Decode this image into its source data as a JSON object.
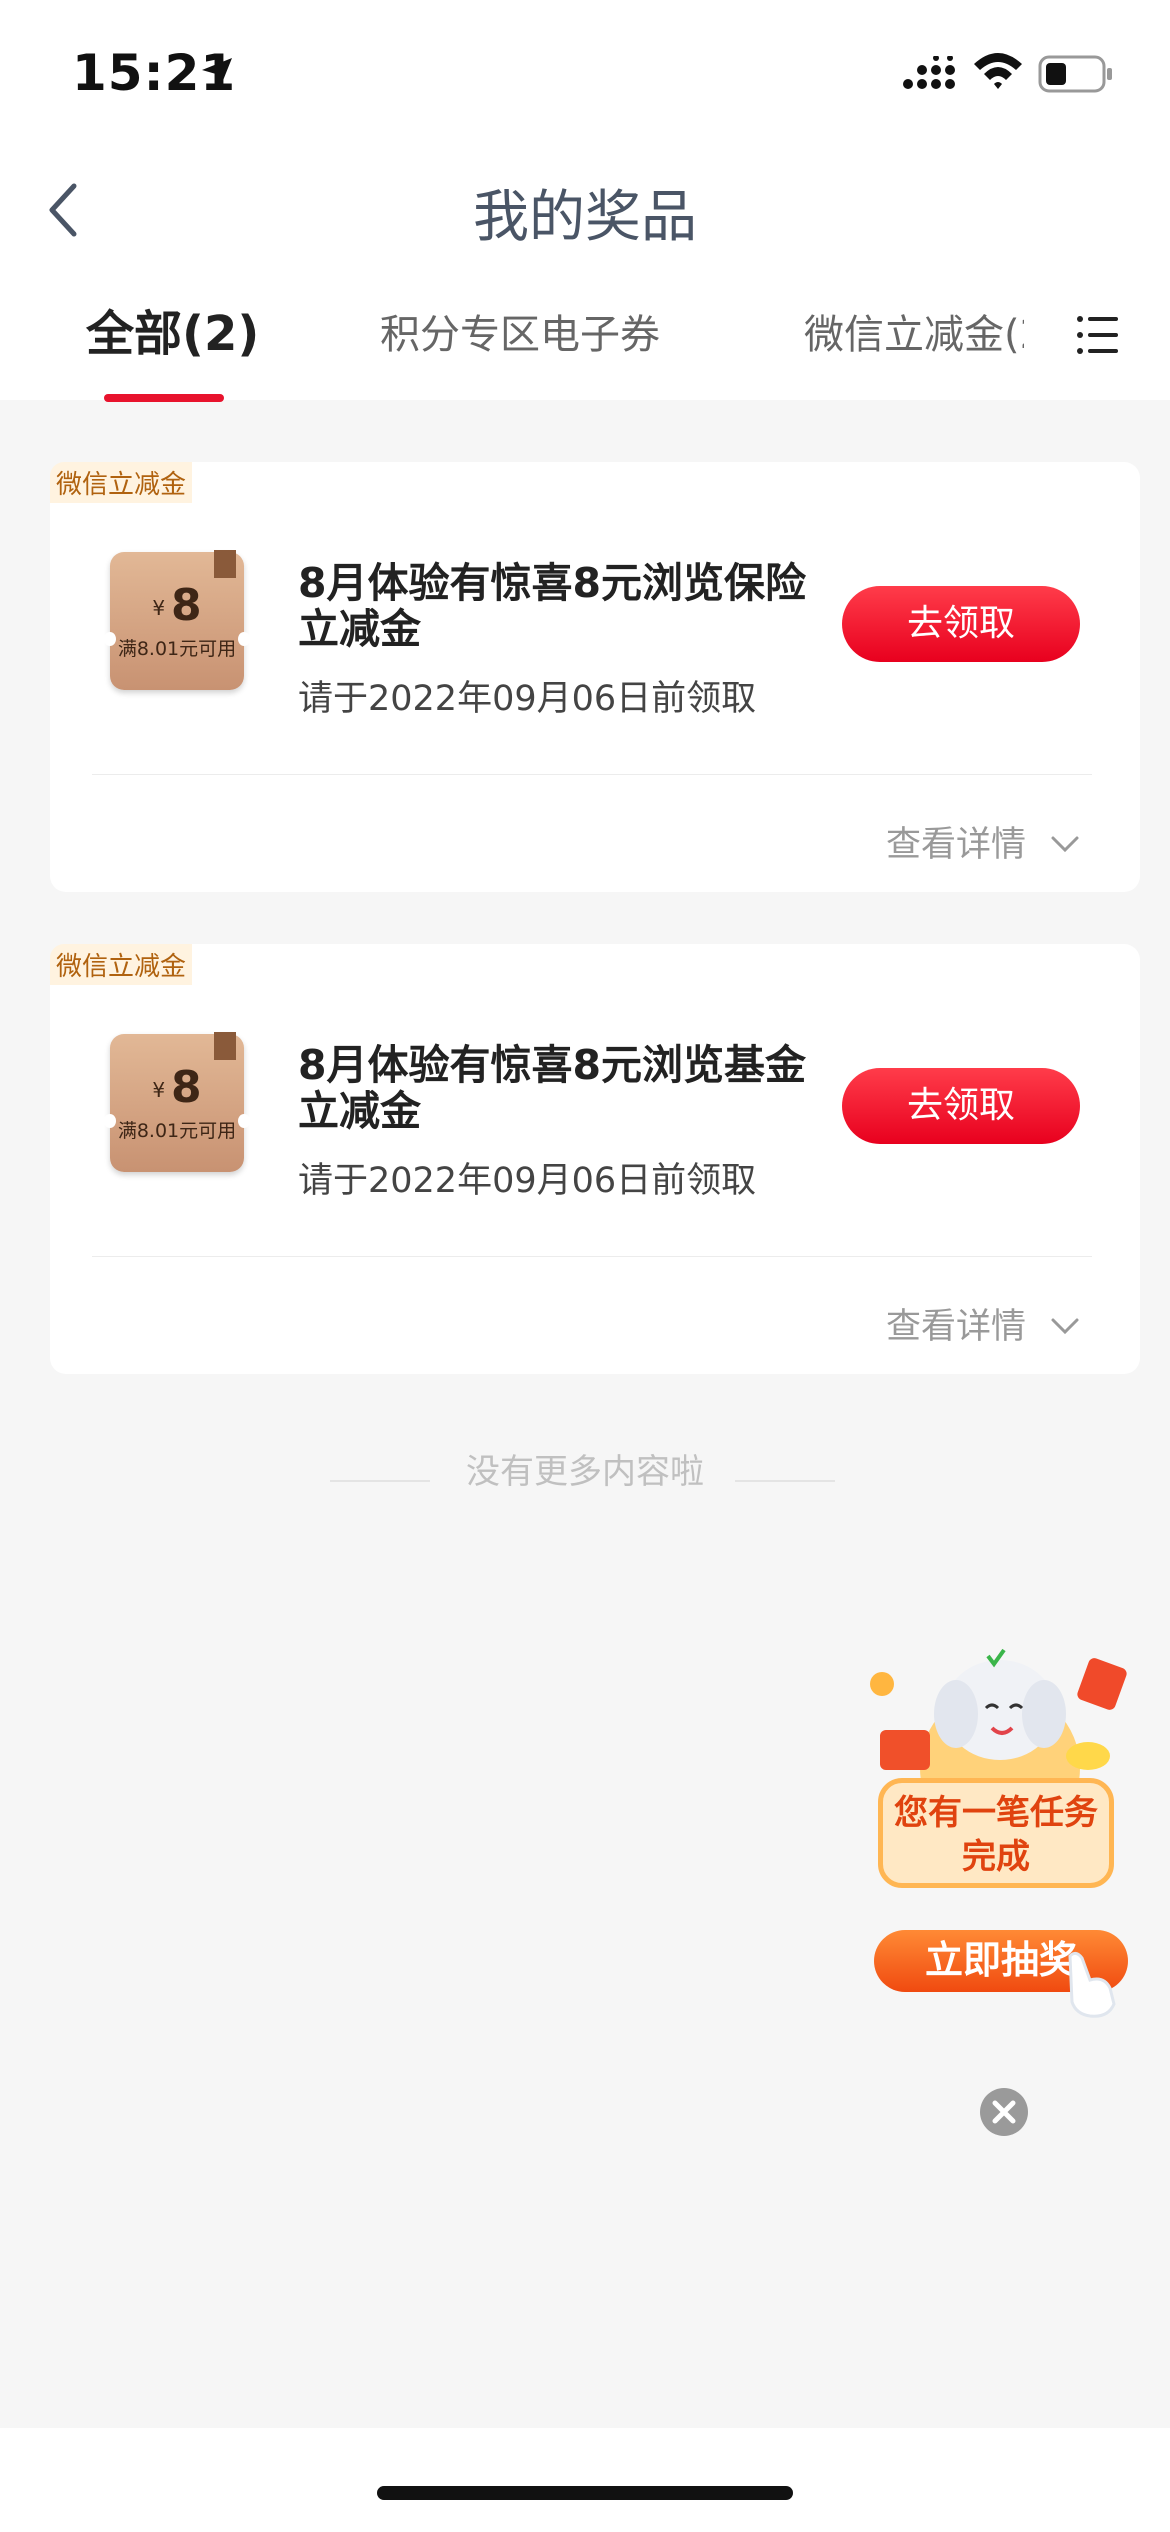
{
  "status_bar": {
    "time": "15:21"
  },
  "header": {
    "title": "我的奖品"
  },
  "tabs": [
    {
      "label": "全部(2)"
    },
    {
      "label": "积分专区电子券"
    },
    {
      "label": "微信立减金(2"
    }
  ],
  "prizes": [
    {
      "tag": "微信立减金",
      "coupon_amount": "8",
      "coupon_currency": "¥",
      "coupon_condition": "满8.01元可用",
      "title": "8月体验有惊喜8元浏览保险立减金",
      "deadline": "请于2022年09月06日前领取",
      "claim_label": "去领取",
      "details_label": "查看详情"
    },
    {
      "tag": "微信立减金",
      "coupon_amount": "8",
      "coupon_currency": "¥",
      "coupon_condition": "满8.01元可用",
      "title": "8月体验有惊喜8元浏览基金立减金",
      "deadline": "请于2022年09月06日前领取",
      "claim_label": "去领取",
      "details_label": "查看详情"
    }
  ],
  "footer": {
    "no_more": "没有更多内容啦"
  },
  "promo": {
    "message": "您有一笔任务完成",
    "button": "立即抽奖"
  },
  "colors": {
    "accent": "#e8132d",
    "tag_bg": "#fff3e0",
    "tag_text": "#b0620f"
  }
}
